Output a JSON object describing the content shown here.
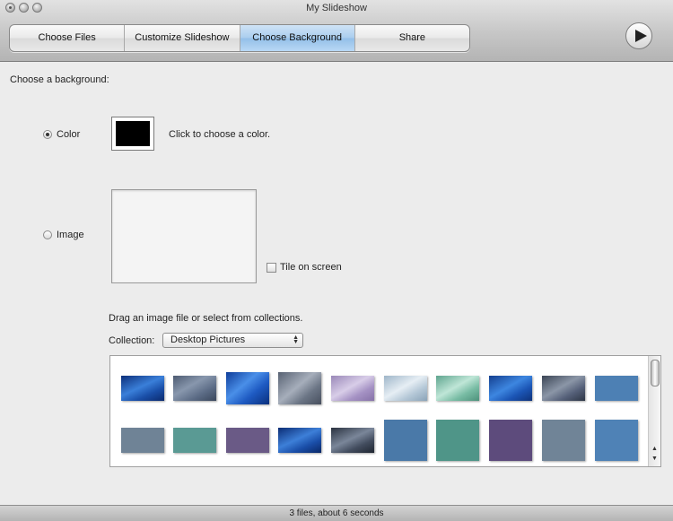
{
  "window": {
    "title": "My Slideshow"
  },
  "tabs": [
    {
      "label": "Choose Files",
      "active": false
    },
    {
      "label": "Customize Slideshow",
      "active": false
    },
    {
      "label": "Choose Background",
      "active": true
    },
    {
      "label": "Share",
      "active": false
    }
  ],
  "main": {
    "heading": "Choose a background:",
    "color_option": {
      "label": "Color",
      "selected": true,
      "hint": "Click to choose a color.",
      "value": "#000000"
    },
    "image_option": {
      "label": "Image",
      "selected": false
    },
    "tile_checkbox": {
      "label": "Tile on screen",
      "checked": false
    },
    "drag_hint": "Drag an image file or select from collections.",
    "collection_label": "Collection:",
    "collection_value": "Desktop Pictures"
  },
  "status": {
    "text": "3 files, about 6 seconds"
  },
  "colors": {
    "active_tab": "#a9cdee",
    "selected_swatch": "#000000"
  },
  "icons": {
    "play": "play-icon"
  }
}
